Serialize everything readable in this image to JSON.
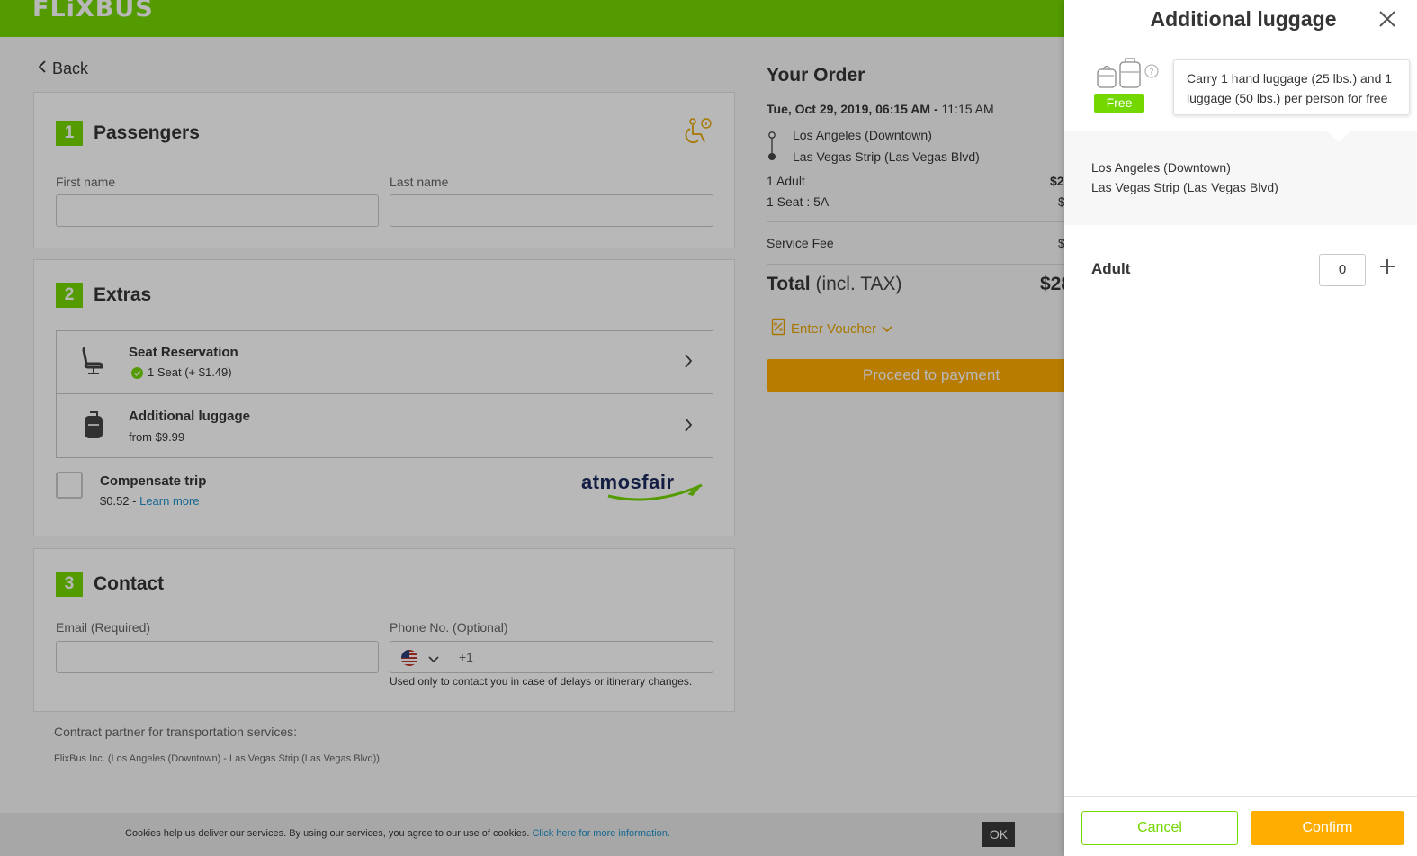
{
  "header": {
    "logo": "FLiXBUS"
  },
  "nav": {
    "back_label": "Back"
  },
  "passengers": {
    "step": "1",
    "title": "Passengers",
    "first_name_label": "First name",
    "last_name_label": "Last name",
    "first_name_value": "",
    "last_name_value": ""
  },
  "extras": {
    "step": "2",
    "title": "Extras",
    "seat": {
      "title": "Seat Reservation",
      "sub": "1 Seat (+ $1.49)"
    },
    "luggage": {
      "title": "Additional luggage",
      "sub": "from $9.99"
    },
    "compensate": {
      "title": "Compensate trip",
      "price": "$0.52 - ",
      "link": "Learn more"
    },
    "partner_logo": "atmosfair"
  },
  "contact": {
    "step": "3",
    "title": "Contact",
    "email_label": "Email (Required)",
    "phone_label": "Phone No. (Optional)",
    "phone_prefix": "+1",
    "phone_hint": "Used only to contact you in case of delays or itinerary changes."
  },
  "footer": {
    "contract_title": "Contract partner for transportation services:",
    "contract_detail": "FlixBus Inc. (Los Angeles (Downtown) - Las Vegas Strip (Las Vegas Blvd))"
  },
  "order": {
    "title": "Your Order",
    "date": "Tue, Oct 29, 2019, 06:15 AM -",
    "arrival": "11:15 AM",
    "from": "Los Angeles (Downtown)",
    "to": "Las Vegas Strip (Las Vegas Blvd)",
    "adult": "1 Adult",
    "adult_price": "$2",
    "seat": "1 Seat : 5A",
    "seat_price": "$",
    "service_fee": "Service Fee",
    "service_fee_price": "$",
    "total_label": "Total",
    "total_suffix": "(incl. TAX)",
    "total_price": "$28",
    "voucher": "Enter Voucher",
    "proceed": "Proceed to payment"
  },
  "cookie": {
    "text": "Cookies help us deliver our services. By using our services, you agree to our use of cookies. ",
    "link": "Click here for more information.",
    "ok": "OK"
  },
  "panel": {
    "title": "Additional luggage",
    "badge": "Free",
    "tooltip": "Carry 1 hand luggage (25 lbs.) and 1 luggage (50 lbs.) per person for free",
    "from": "Los Angeles (Downtown)",
    "to": "Las Vegas Strip (Las Vegas Blvd)",
    "adult_label": "Adult",
    "adult_qty": "0",
    "cancel": "Cancel",
    "confirm": "Confirm"
  },
  "colors": {
    "brand": "#73d700",
    "accent": "#ffad00",
    "link": "#1e90c8"
  }
}
